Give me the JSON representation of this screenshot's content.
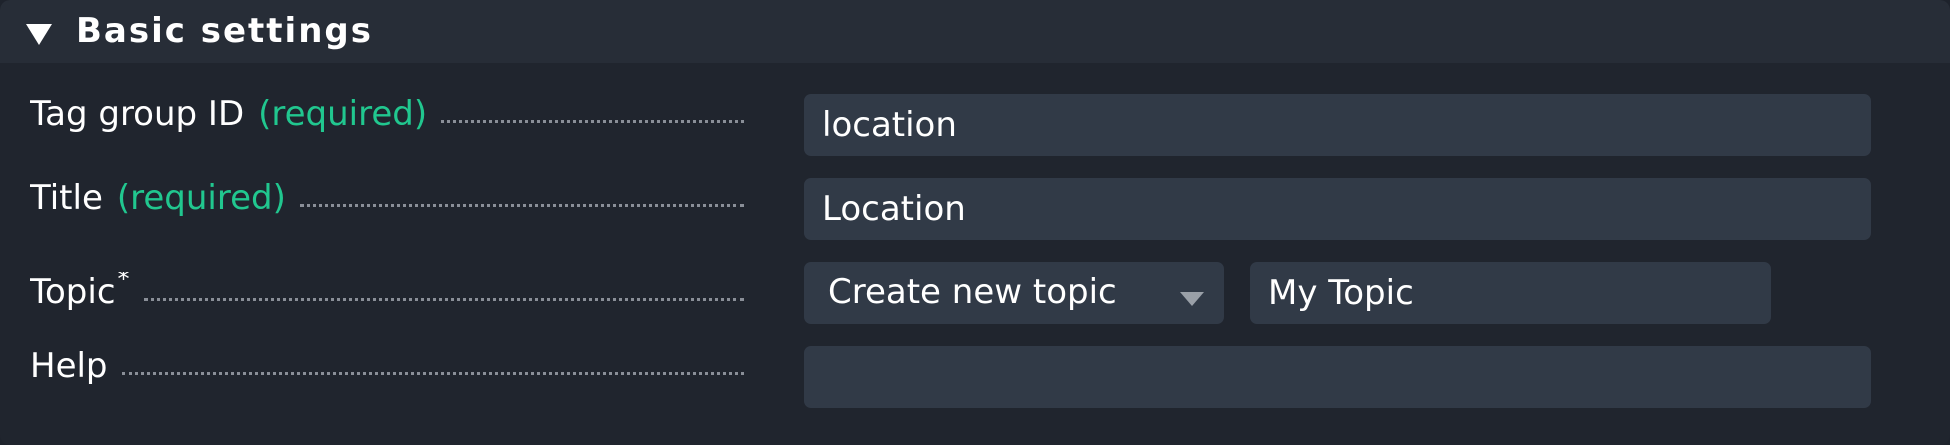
{
  "section": {
    "title": "Basic settings"
  },
  "fields": {
    "tag_group_id": {
      "label": "Tag group ID",
      "required_label": "(required)",
      "value": "location"
    },
    "title": {
      "label": "Title",
      "required_label": "(required)",
      "value": "Location"
    },
    "topic": {
      "label": "Topic",
      "marker": "*",
      "select_value": "Create new topic",
      "input_value": "My Topic"
    },
    "help": {
      "label": "Help",
      "value": ""
    }
  },
  "colors": {
    "background": "#20252e",
    "header": "#272d37",
    "input": "#313a47",
    "required": "#21c78f",
    "text": "#ffffff"
  }
}
